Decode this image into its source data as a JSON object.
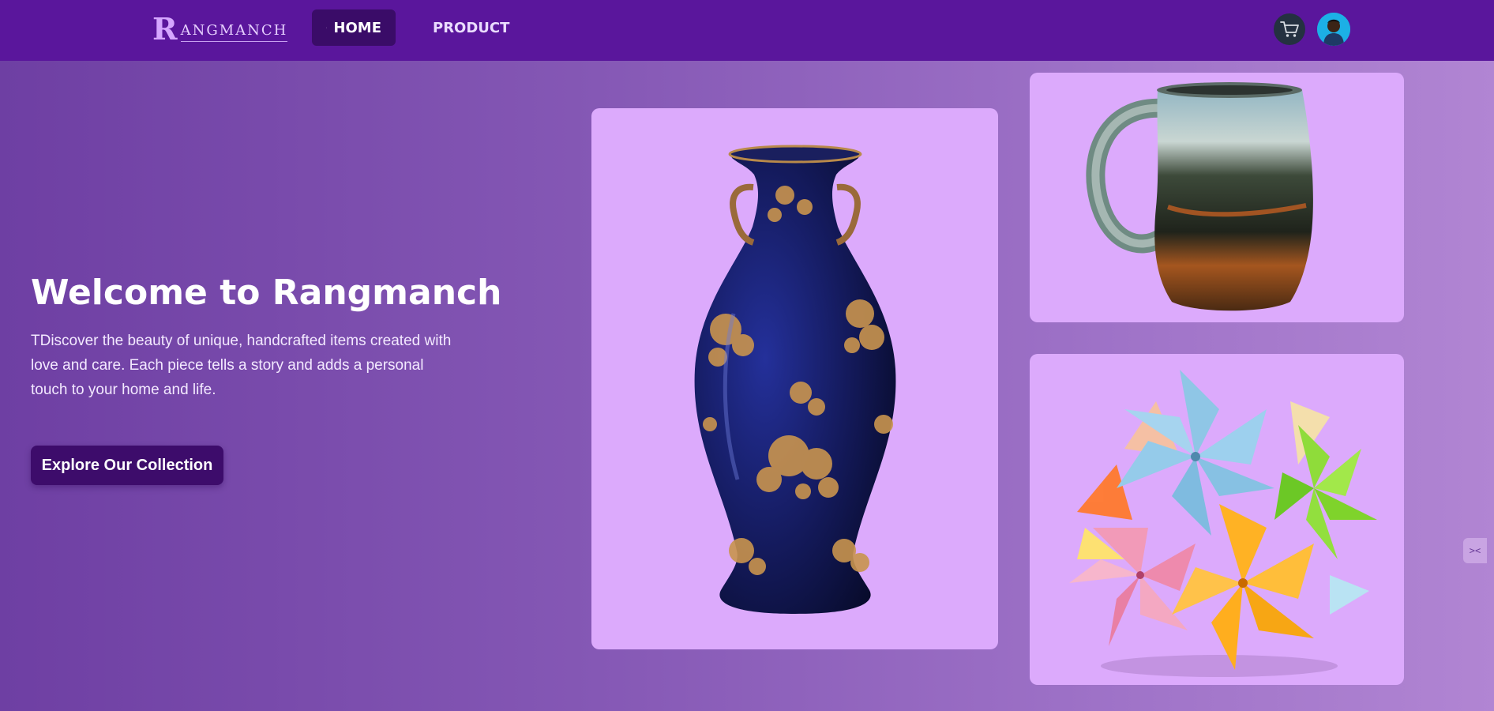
{
  "brand": {
    "logo_mark": "R",
    "logo_text": "ANGMANCH"
  },
  "nav": {
    "home_label": "HOME",
    "product_label": "PRODUCT"
  },
  "hero": {
    "title": "Welcome to Rangmanch",
    "description": "TDiscover the beauty of unique, handcrafted items created with love and care. Each piece tells a story and adds a personal touch to your home and life.",
    "cta_label": "Explore Our Collection"
  },
  "side_tab": {
    "label": "><"
  },
  "colors": {
    "navbar": "#5a169c",
    "nav_active": "#3a0c68",
    "card_bg": "#dcaafc",
    "cta_bg": "#3d0c6b"
  },
  "icons": {
    "home": "home-icon",
    "product": "bag-icon",
    "cart": "cart-icon",
    "avatar": "user-avatar"
  }
}
